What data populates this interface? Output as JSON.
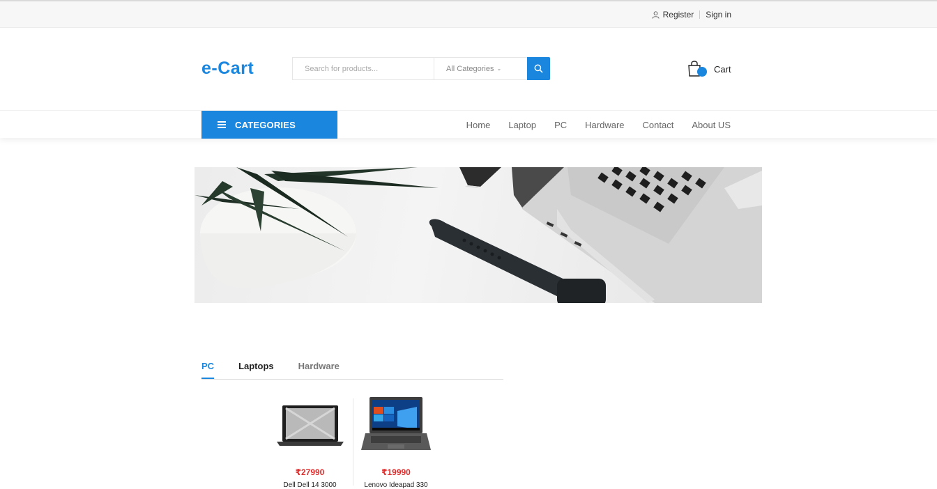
{
  "topbar": {
    "register": "Register",
    "signin": "Sign in"
  },
  "header": {
    "logo": "e-Cart",
    "search_placeholder": "Search for products...",
    "category_select": "All Categories",
    "cart_label": "Cart"
  },
  "nav": {
    "categories_label": "CATEGORIES",
    "menu": [
      "Home",
      "Laptop",
      "PC",
      "Hardware",
      "Contact",
      "About US"
    ]
  },
  "tabs": [
    "PC",
    "Laptops",
    "Hardware"
  ],
  "products": [
    {
      "price": "₹27990",
      "name": "Dell Dell 14 3000"
    },
    {
      "price": "₹19990",
      "name": "Lenovo Ideapad 330"
    }
  ],
  "colors": {
    "accent": "#1a86de",
    "price": "#e02b2b"
  }
}
